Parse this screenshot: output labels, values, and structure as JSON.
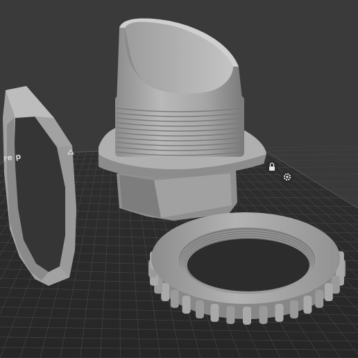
{
  "viewport": {
    "background": "#3a3a3a",
    "bed_color": "#2b2b2b",
    "grid_color": "#4a4a4a",
    "part_color": "#a3a3a3"
  },
  "plate": {
    "label": "re p"
  },
  "icons": {
    "lock": "lock-icon",
    "settings": "gear-icon"
  }
}
